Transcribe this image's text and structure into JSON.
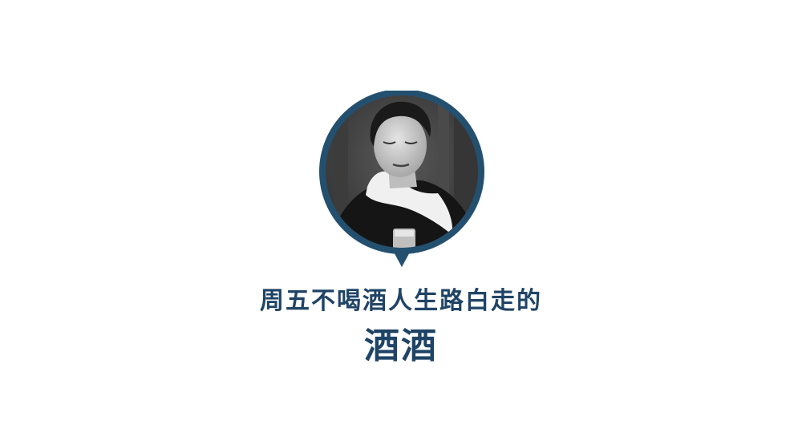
{
  "colors": {
    "accent": "#24506f",
    "text": "#1f4466",
    "background": "#ffffff"
  },
  "badge": {
    "icon": "portrait-speech-bubble-icon"
  },
  "headline": "周五不喝酒人生路白走的",
  "subheadline": "酒酒"
}
